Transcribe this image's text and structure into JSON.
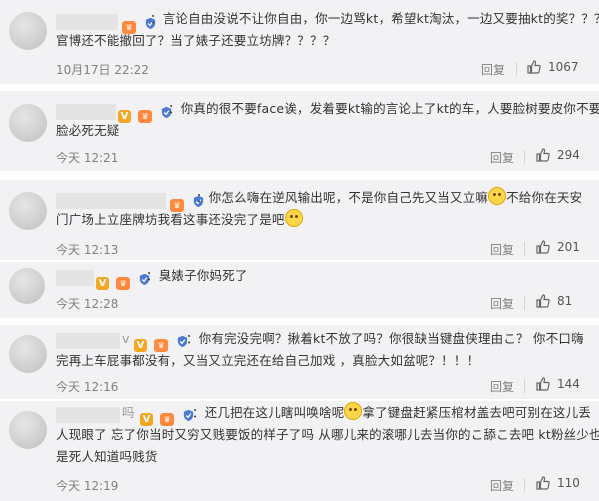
{
  "comments": [
    {
      "line1": "：言论自由没说不让你自由，你一边骂kt，希望kt淘汰，一边又要抽kt的奖？？？",
      "line2": "官博还不能撤回了？当了婊子还要立坊牌？？？？",
      "time": "10月17日 22:22",
      "reply": "回复",
      "likes": "1067"
    },
    {
      "line1": "：你真的很不要face诶，发着要kt输的言论上了kt的车，人要脸树要皮你不要",
      "line2": "脸必死无疑",
      "time": "今天 12:21",
      "reply": "回复",
      "likes": "294"
    },
    {
      "line1a": "：你怎么嗨在逆风输出呢，不是你自己先又当又立嘛",
      "line1b": "不给你在天安",
      "line2": "门广场上立座牌坊我看这事还没完了是吧",
      "time": "今天 12:13",
      "reply": "回复",
      "likes": "201"
    },
    {
      "line1": "：臭婊子你妈死了",
      "time": "今天 12:28",
      "reply": "回复",
      "likes": "81"
    },
    {
      "name_tail": "v",
      "line1": "：你有完没完啊？揪着kt不放了吗？你很缺当键盘侠理由こ？ 你不口嗨",
      "line2": "完再上车屁事都没有，又当又立完还在给自己加戏 ，真脸大如盆呢？！！！",
      "time": "今天 12:16",
      "reply": "回复",
      "likes": "144"
    },
    {
      "name_tail": "吗",
      "line1a": "：还几把在这儿瞎叫唤啥呢",
      "line1b": "拿了键盘赶紧压棺材盖去吧可别在这儿丢",
      "line2": "人现眼了 忘了你当时又穷又贱要饭的样子了吗 从哪儿来的滚哪儿去当你的こ舔こ去吧 kt粉丝少也不",
      "line3": "是死人知道吗贱货",
      "time": "今天 12:19",
      "reply": "回复",
      "likes": "110"
    }
  ],
  "icons": {
    "vip": "V",
    "like": "thumbs-up-icon",
    "shield": "shield-icon",
    "emoji": "smiley-icon"
  }
}
